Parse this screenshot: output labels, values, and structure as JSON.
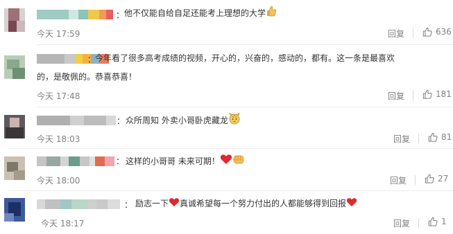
{
  "reply_label": "回复",
  "comments": [
    {
      "text": "他不仅能自给自足还能考上理想的大学",
      "time": "今天 17:59",
      "likes": "636"
    },
    {
      "text_line1": "今年看了很多高考成绩的视频，开心的，兴奋的，感动的，都有。这一条是最喜欢",
      "text_line2": "的，是敬佩的。恭喜恭喜！",
      "time": "今天 17:48",
      "likes": "181"
    },
    {
      "text": "众所周知 外卖小哥卧虎藏龙",
      "time": "今天 18:03",
      "likes": "81"
    },
    {
      "text": "这样的小哥哥  未来可期！",
      "time": "今天 18:00",
      "likes": "27"
    },
    {
      "text_part1": "励志一下",
      "text_part2": "真诚希望每一个努力付出的人都能够得到回报",
      "time": "今天 18:17",
      "likes": "1"
    }
  ],
  "icons": {
    "like": "thumbs-up-icon",
    "thumbs_emoji": "thumbs-up-emoji",
    "heart_emoji": "red-heart-emoji",
    "fist_emoji": "fist-emoji",
    "tiger_emoji": "tiger-emoji"
  },
  "colors": {
    "text": "#333333",
    "meta": "#808080",
    "heart": "#e0282e"
  }
}
